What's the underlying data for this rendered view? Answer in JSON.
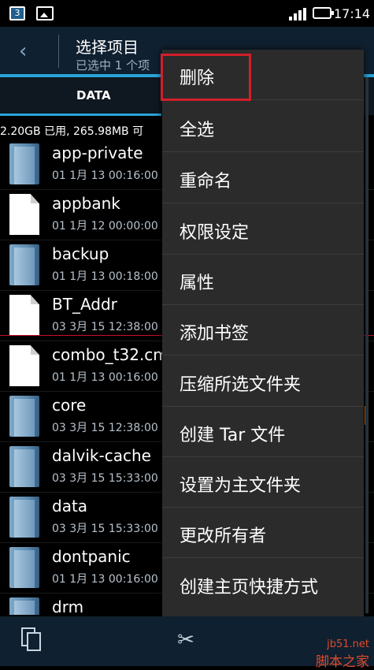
{
  "status_bar": {
    "notification_badge": "3",
    "time": "17:14",
    "icons": [
      "notification-badge-icon",
      "image-icon",
      "signal-icon",
      "battery-icon"
    ]
  },
  "action_bar": {
    "title": "选择项目",
    "subtitle": "已选中 1 个项",
    "back_icon": "chevron-left-icon"
  },
  "tabs": {
    "active": "DATA"
  },
  "storage_info": "2.20GB 已用, 265.98MB 可",
  "files": [
    {
      "name": "app-private",
      "date": "01 1月 13 00:16:00",
      "type": "folder"
    },
    {
      "name": "appbank",
      "date": "01 1月 12 00:00:00",
      "type": "file"
    },
    {
      "name": "backup",
      "date": "01 1月 13 00:18:00",
      "type": "folder"
    },
    {
      "name": "BT_Addr",
      "date": "03 3月 15 12:38:00",
      "type": "file"
    },
    {
      "name": "combo_t32.cm",
      "date": "01 1月 13 00:16:00",
      "type": "file"
    },
    {
      "name": "core",
      "date": "03 3月 15 12:38:00",
      "type": "folder"
    },
    {
      "name": "dalvik-cache",
      "date": "03 3月 15 15:33:00",
      "type": "folder"
    },
    {
      "name": "data",
      "date": "03 3月 15 15:33:00",
      "type": "folder"
    },
    {
      "name": "dontpanic",
      "date": "01 1月 13 00:16:00",
      "type": "folder"
    },
    {
      "name": "drm",
      "date": "",
      "type": "folder"
    }
  ],
  "context_menu": [
    "删除",
    "全选",
    "重命名",
    "权限设定",
    "属性",
    "添加书签",
    "压缩所选文件夹",
    "创建 Tar 文件",
    "设置为主文件夹",
    "更改所有者",
    "创建主页快捷方式"
  ],
  "bottom_bar": {
    "icons": [
      "copy-icon",
      "cut-icon"
    ]
  },
  "watermark": {
    "line1": "jb51.net",
    "line2": "脚本之家"
  },
  "colors": {
    "accent": "#2aa3d8",
    "highlight_border": "#d21f2a",
    "menu_bg": "#2b2b2b",
    "action_bar_bg": "#0f2030"
  }
}
